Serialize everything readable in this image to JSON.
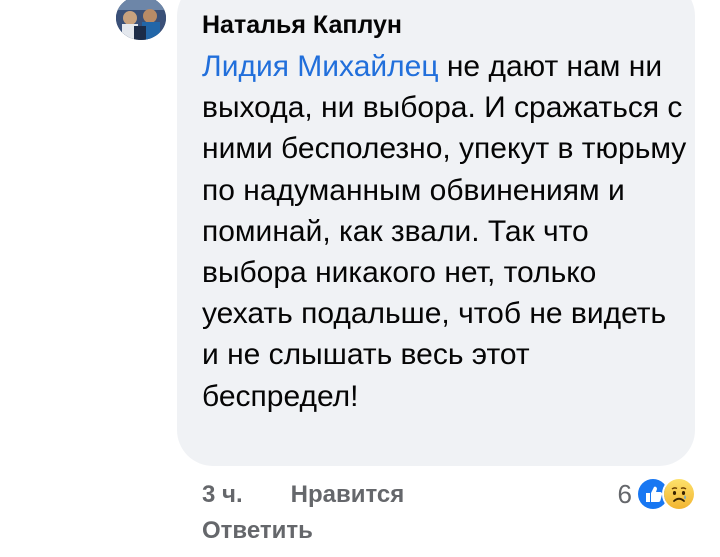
{
  "comment": {
    "author": "Наталья Каплун",
    "mention": "Лидия Михайлец",
    "text": " не дают нам ни выхода, ни выбора. И сражаться с ними бесполезно, упекут в тюрьму по надуманным обвинениям и поминай, как звали. Так что выбора никакого нет, только уехать подальше, чтоб не видеть и не слышать весь этот беспредел!"
  },
  "actions": {
    "time": "3 ч.",
    "like_label": "Нравится",
    "reply_label": "Ответить"
  },
  "reactions": {
    "count": "6",
    "icons": [
      "like-icon",
      "sad-icon"
    ]
  },
  "colors": {
    "bubble_bg": "#f0f2f5",
    "mention": "#216fdb",
    "meta_text": "#65676b",
    "like_blue": "#1877f2",
    "sad_yellow": "#f7c23b"
  }
}
